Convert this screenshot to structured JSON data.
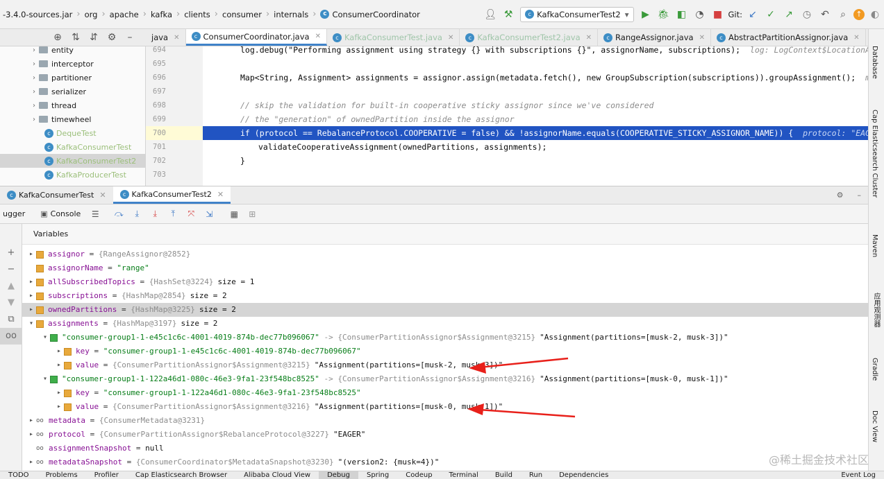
{
  "navbar": {
    "crumbs": [
      "-3.4.0-sources.jar",
      "org",
      "apache",
      "kafka",
      "clients",
      "consumer",
      "internals",
      "ConsumerCoordinator"
    ],
    "run_config": "KafkaConsumerTest2",
    "git_label": "Git:"
  },
  "project": {
    "tree": [
      {
        "label": "entity",
        "type": "folder"
      },
      {
        "label": "interceptor",
        "type": "folder"
      },
      {
        "label": "partitioner",
        "type": "folder"
      },
      {
        "label": "serializer",
        "type": "folder"
      },
      {
        "label": "thread",
        "type": "folder"
      },
      {
        "label": "timewheel",
        "type": "folder"
      },
      {
        "label": "DequeTest",
        "type": "class"
      },
      {
        "label": "KafkaConsumerTest",
        "type": "class"
      },
      {
        "label": "KafkaConsumerTest2",
        "type": "class"
      },
      {
        "label": "KafkaProducerTest",
        "type": "class"
      }
    ]
  },
  "editor": {
    "tabs": [
      {
        "label": "java",
        "state": "normal"
      },
      {
        "label": "ConsumerCoordinator.java",
        "state": "active"
      },
      {
        "label": "KafkaConsumerTest.java",
        "state": "faded"
      },
      {
        "label": "KafkaConsumerTest2.java",
        "state": "faded"
      },
      {
        "label": "RangeAssignor.java",
        "state": "normal"
      },
      {
        "label": "AbstractPartitionAssignor.java",
        "state": "normal"
      }
    ],
    "line_numbers": [
      "694",
      "695",
      "696",
      "697",
      "698",
      "699",
      "700",
      "701",
      "702",
      "703"
    ],
    "code": {
      "l694": "log.debug(\"Performing assignment using strategy {} with subscriptions {}\", assignorName, subscriptions);",
      "l694_hint": "log: LogContext$LocationAwareKa",
      "l696": "Map<String, Assignment> assignments = assignor.assign(metadata.fetch(), new GroupSubscription(subscriptions)).groupAssignment();",
      "l696_hint": "metadat",
      "l698": "// skip the validation for built-in cooperative sticky assignor since we've considered",
      "l699": "// the \"generation\" of ownedPartition inside the assignor",
      "l700": "if (protocol == RebalanceProtocol.COOPERATIVE = false) && !assignorName.equals(COOPERATIVE_STICKY_ASSIGNOR_NAME)) {",
      "l700_hint": "protocol: \"EAGER\"",
      "l701": "validateCooperativeAssignment(ownedPartitions, assignments);",
      "l702": "}"
    }
  },
  "debug": {
    "tabs": [
      "KafkaConsumerTest",
      "KafkaConsumerTest2"
    ],
    "toolbar": {
      "debugger_label": "ugger",
      "console_label": "Console"
    },
    "variables_label": "Variables",
    "variables": [
      {
        "indent": 0,
        "arrow": "▸",
        "icon": "field",
        "name": "assignor",
        "ref": "{RangeAssignor@2852}",
        "value": ""
      },
      {
        "indent": 0,
        "arrow": "",
        "icon": "field",
        "name": "assignorName",
        "ref": "",
        "value": "\"range\"",
        "str": true
      },
      {
        "indent": 0,
        "arrow": "▸",
        "icon": "field",
        "name": "allSubscribedTopics",
        "ref": "{HashSet@3224}",
        "value": "size = 1"
      },
      {
        "indent": 0,
        "arrow": "▸",
        "icon": "field",
        "name": "subscriptions",
        "ref": "{HashMap@2854}",
        "value": "size = 2"
      },
      {
        "indent": 0,
        "arrow": "▸",
        "icon": "field",
        "name": "ownedPartitions",
        "ref": "{HashMap@3225}",
        "value": "size = 2",
        "selected": true
      },
      {
        "indent": 0,
        "arrow": "▾",
        "icon": "field",
        "name": "assignments",
        "ref": "{HashMap@3197}",
        "value": "size = 2"
      },
      {
        "indent": 1,
        "arrow": "▾",
        "icon": "entry",
        "name": "\"consumer-group1-1-e45c1c6c-4001-4019-874b-dec77b096067\"",
        "ref": "-> {ConsumerPartitionAssignor$Assignment@3215}",
        "value": "\"Assignment(partitions=[musk-2, musk-3])\"",
        "entry": true
      },
      {
        "indent": 2,
        "arrow": "▸",
        "icon": "field",
        "name": "key",
        "ref": "",
        "value": "\"consumer-group1-1-e45c1c6c-4001-4019-874b-dec77b096067\"",
        "str": true
      },
      {
        "indent": 2,
        "arrow": "▸",
        "icon": "field",
        "name": "value",
        "ref": "{ConsumerPartitionAssignor$Assignment@3215}",
        "value": "\"Assignment(partitions=[musk-2, musk-3])\""
      },
      {
        "indent": 1,
        "arrow": "▾",
        "icon": "entry",
        "name": "\"consumer-group1-1-122a46d1-080c-46e3-9fa1-23f548bc8525\"",
        "ref": "-> {ConsumerPartitionAssignor$Assignment@3216}",
        "value": "\"Assignment(partitions=[musk-0, musk-1])\"",
        "entry": true
      },
      {
        "indent": 2,
        "arrow": "▸",
        "icon": "field",
        "name": "key",
        "ref": "",
        "value": "\"consumer-group1-1-122a46d1-080c-46e3-9fa1-23f548bc8525\"",
        "str": true
      },
      {
        "indent": 2,
        "arrow": "▸",
        "icon": "field",
        "name": "value",
        "ref": "{ConsumerPartitionAssignor$Assignment@3216}",
        "value": "\"Assignment(partitions=[musk-0, musk-1])\""
      },
      {
        "indent": 0,
        "arrow": "▸",
        "icon": "oo",
        "name": "metadata",
        "ref": "{ConsumerMetadata@3231}",
        "value": ""
      },
      {
        "indent": 0,
        "arrow": "▸",
        "icon": "oo",
        "name": "protocol",
        "ref": "{ConsumerPartitionAssignor$RebalanceProtocol@3227}",
        "value": "\"EAGER\""
      },
      {
        "indent": 0,
        "arrow": "",
        "icon": "oo",
        "name": "assignmentSnapshot",
        "ref": "",
        "value": "null"
      },
      {
        "indent": 0,
        "arrow": "▸",
        "icon": "oo",
        "name": "metadataSnapshot",
        "ref": "{ConsumerCoordinator$MetadataSnapshot@3230}",
        "value": "\"(version2: {musk=4})\""
      }
    ]
  },
  "right_strip": [
    "Database",
    "Cap Elasticsearch Cluster",
    "Maven",
    "应用观测器",
    "Gradle",
    "Doc View"
  ],
  "statusbar": [
    "TODO",
    "Problems",
    "Profiler",
    "Cap Elasticsearch Browser",
    "Alibaba Cloud View",
    "Debug",
    "Spring",
    "Codeup",
    "Terminal",
    "Build",
    "Run",
    "Dependencies",
    "Event Log"
  ],
  "watermark": "@稀土掘金技术社区",
  "colors": {
    "accent": "#4083c9",
    "highlight_line": "#2154c2",
    "arrow_red": "#e8201a"
  }
}
